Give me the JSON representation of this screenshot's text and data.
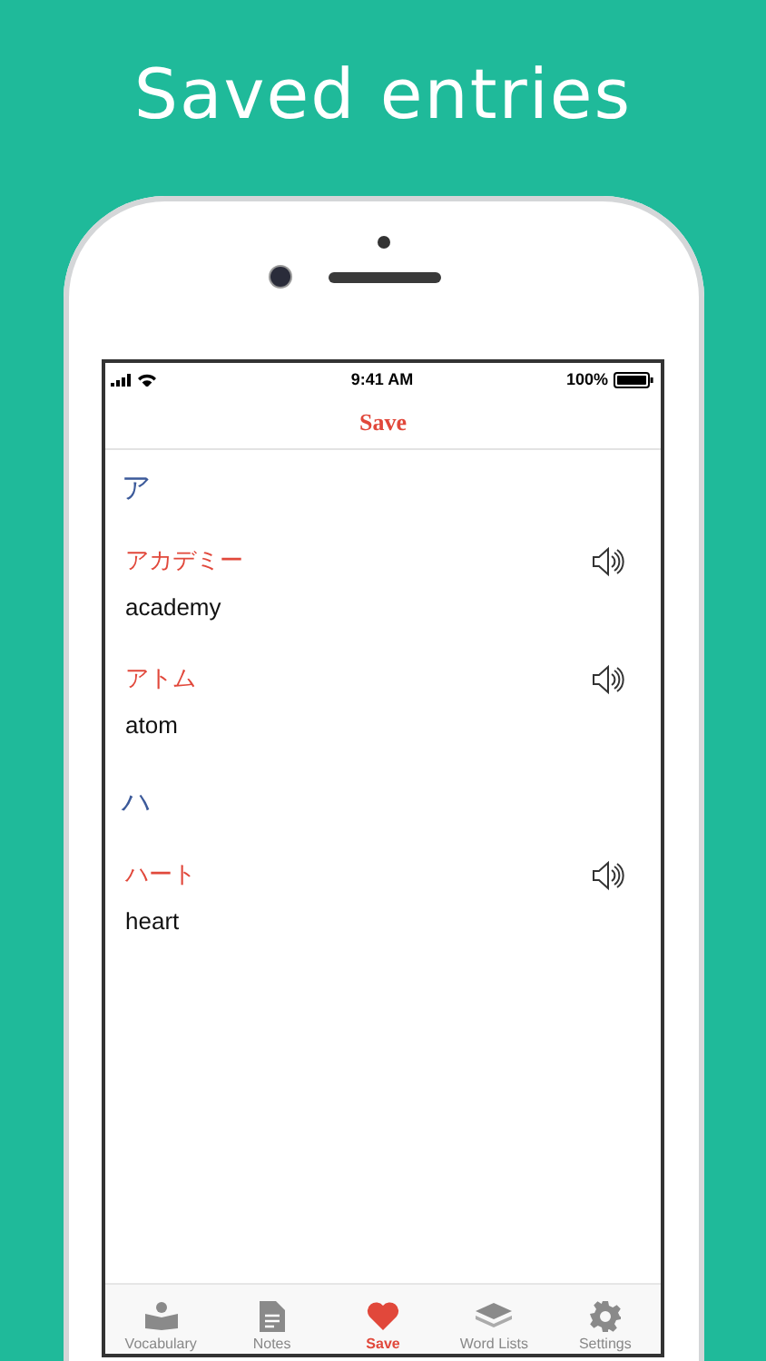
{
  "headline": "Saved entries",
  "status_bar": {
    "time": "9:41 AM",
    "battery": "100%"
  },
  "nav": {
    "title": "Save"
  },
  "sections": [
    {
      "heading": "ア",
      "entries": [
        {
          "kana": "アカデミー",
          "meaning": "academy"
        },
        {
          "kana": "アトム",
          "meaning": "atom"
        }
      ]
    },
    {
      "heading": "ハ",
      "entries": [
        {
          "kana": "ハート",
          "meaning": "heart"
        }
      ]
    }
  ],
  "tabs": [
    {
      "label": "Vocabulary",
      "selected": false
    },
    {
      "label": "Notes",
      "selected": false
    },
    {
      "label": "Save",
      "selected": true
    },
    {
      "label": "Word Lists",
      "selected": false
    },
    {
      "label": "Settings",
      "selected": false
    }
  ]
}
